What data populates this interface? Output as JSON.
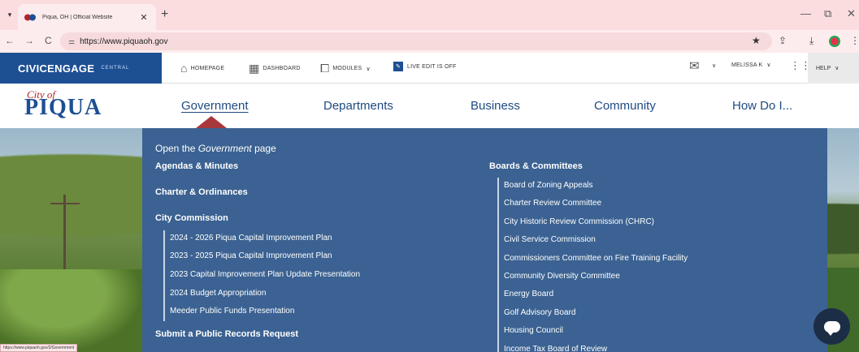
{
  "browser": {
    "tab_title": "Piqua, OH | Official Website",
    "url": "https://www.piquaoh.gov",
    "status_url": "https://www.piquaoh.gov/2/Government",
    "icons": {
      "menu": "▾",
      "close": "✕",
      "new_tab": "+",
      "minimize": "—",
      "maximize": "⧉",
      "window_close": "✕",
      "back": "←",
      "forward": "→",
      "reload": "C",
      "site_info": "⚌",
      "star": "★",
      "extensions": "⇪",
      "download": "⤓",
      "more": "⋮"
    }
  },
  "admin_bar": {
    "brand": "CIVICENGAGE",
    "brand_sub": "CENTRAL",
    "homepage": "HOMEPAGE",
    "dashboard": "DASHBOARD",
    "modules": "MODULES",
    "live_edit": "LIVE EDIT IS OFF",
    "user": "MELISSA K",
    "help": "HELP",
    "caret": "∨"
  },
  "site": {
    "logo_city": "City of",
    "logo_name": "PIQUA",
    "nav": [
      "Government",
      "Departments",
      "Business",
      "Community",
      "How Do I..."
    ]
  },
  "dropdown": {
    "open_prefix": "Open the ",
    "open_em": "Government",
    "open_suffix": " page",
    "left_links": [
      "Agendas & Minutes",
      "Charter & Ordinances",
      "City Commission"
    ],
    "commission_sub": [
      "2024 - 2026 Piqua Capital Improvement Plan",
      "2023 - 2025 Piqua Capital Improvement Plan",
      "2023 Capital Improvement Plan Update Presentation",
      "2024 Budget Appropriation",
      "Meeder Public Funds Presentation"
    ],
    "records": "Submit a Public Records Request",
    "boards_heading": "Boards & Committees",
    "boards": [
      "Board of Zoning Appeals",
      "Charter Review Committee",
      "City Historic Review Commission (CHRC)",
      "Civil Service Commission",
      "Commissioners Committee on Fire Training Facility",
      "Community Diversity Committee",
      "Energy Board",
      "Golf Advisory Board",
      "Housing Council",
      "Income Tax Board of Review"
    ]
  },
  "colors": {
    "admin_blue": "#1d4f93",
    "dropdown_bg": "#3b6292",
    "accent_red": "#a9383c"
  }
}
